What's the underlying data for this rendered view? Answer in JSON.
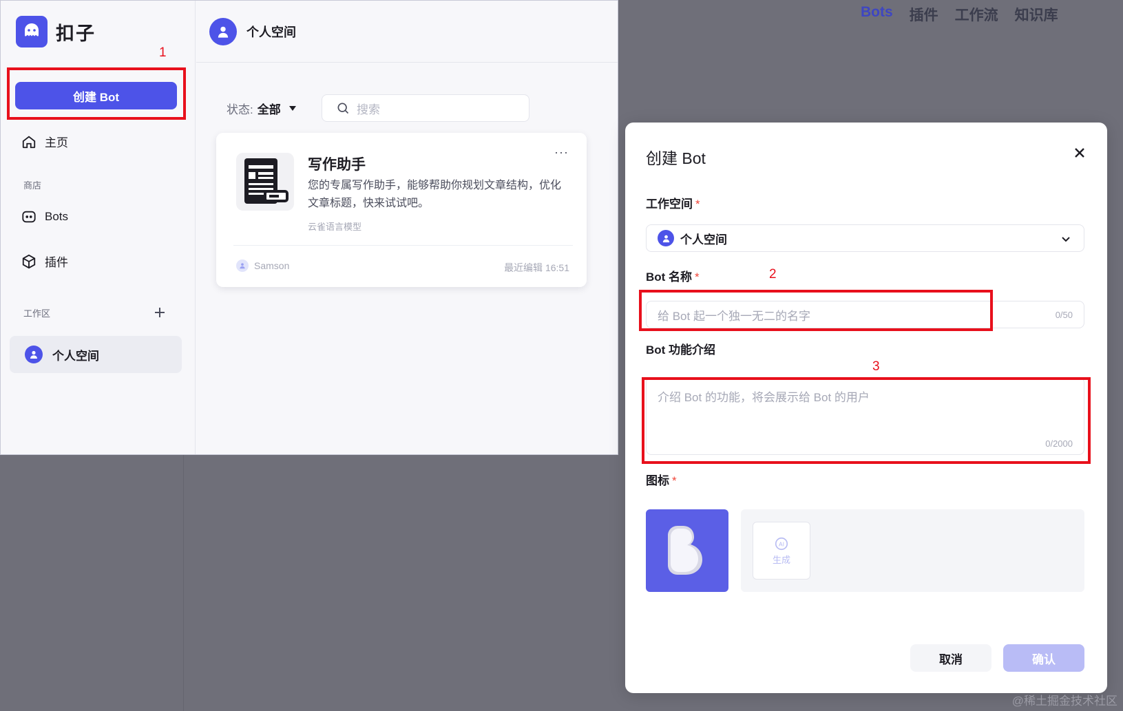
{
  "topnav": {
    "items": [
      "Bots",
      "插件",
      "工作流",
      "知识库"
    ],
    "active": "Bots"
  },
  "sidebar": {
    "brand": "扣子",
    "create_button": "创建 Bot",
    "home": "主页",
    "store_section": "商店",
    "bots": "Bots",
    "plugins": "插件",
    "workspace_section": "工作区",
    "workspace_item": "个人空间"
  },
  "main": {
    "header_title": "个人空间",
    "filter_label": "状态:",
    "filter_value": "全部",
    "search_placeholder": "搜索",
    "card": {
      "title": "写作助手",
      "description": "您的专属写作助手，能够帮助你规划文章结构，优化文章标题，快来试试吧。",
      "model": "云雀语言模型",
      "author": "Samson",
      "last_edit": "最近编辑 16:51"
    }
  },
  "modal": {
    "title": "创建 Bot",
    "workspace_label": "工作空间",
    "workspace_value": "个人空间",
    "name_label": "Bot 名称",
    "name_placeholder": "给 Bot 起一个独一无二的名字",
    "name_counter": "0/50",
    "desc_label": "Bot 功能介绍",
    "desc_placeholder": "介绍 Bot 的功能，将会展示给 Bot 的用户",
    "desc_counter": "0/2000",
    "icon_label": "图标",
    "generate_label": "生成",
    "cancel": "取消",
    "confirm": "确认"
  },
  "annotations": {
    "mark1": "1",
    "mark2": "2",
    "mark3": "3"
  },
  "watermark": "@稀土掘金技术社区",
  "colors": {
    "accent": "#4d53e8",
    "highlight": "#e8101c",
    "required": "#f04438"
  }
}
